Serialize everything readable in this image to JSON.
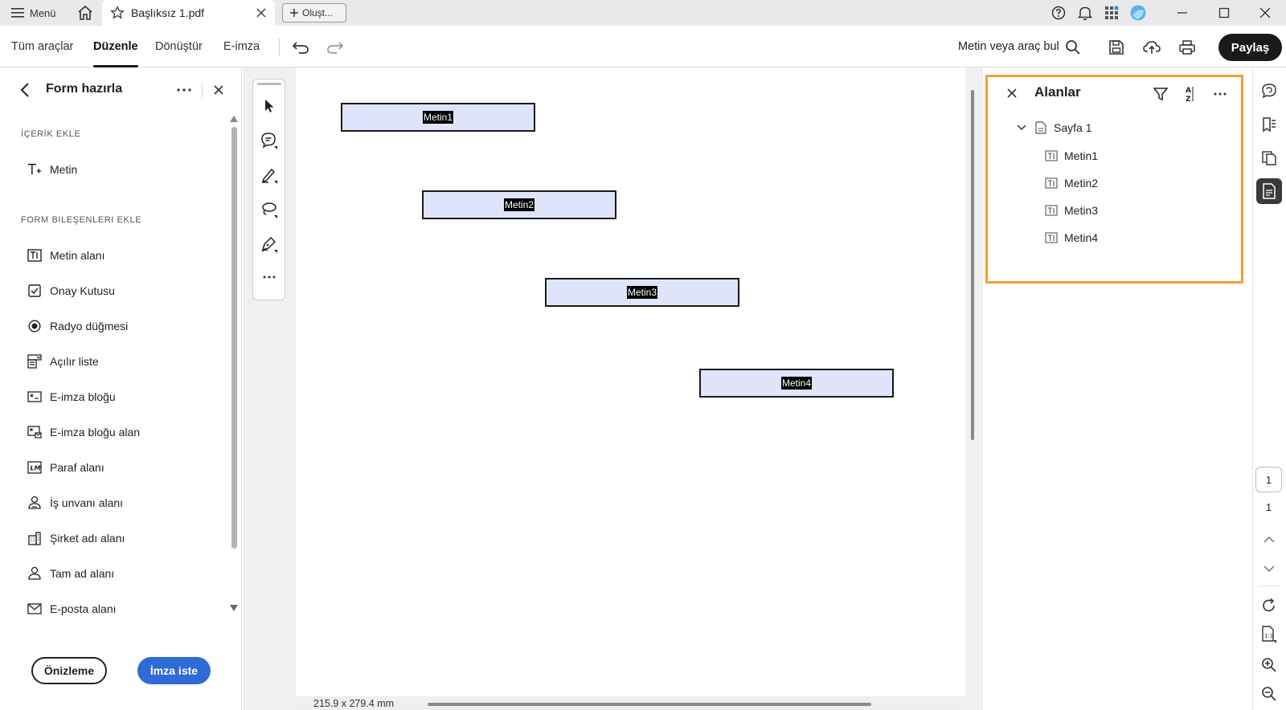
{
  "tabbar": {
    "menu_label": "Menü",
    "doc_tab_title": "Başlıksız 1.pdf",
    "new_tab_label": "Oluşt..."
  },
  "toolbar": {
    "tabs": [
      "Tüm araçlar",
      "Düzenle",
      "Dönüştür",
      "E-imza"
    ],
    "active_tab": "Düzenle",
    "search_label": "Metin veya araç bul",
    "share_label": "Paylaş"
  },
  "left_panel": {
    "title": "Form hazırla",
    "section_content": "İÇERİK EKLE",
    "content_items": [
      "Metin"
    ],
    "section_components": "FORM BILEŞENLERI EKLE",
    "component_items": [
      "Metin alanı",
      "Onay Kutusu",
      "Radyo düğmesi",
      "Açılır liste",
      "E-imza bloğu",
      "E-imza bloğu alan",
      "Paraf alanı",
      "İş unvanı alanı",
      "Şirket adı alanı",
      "Tam ad alanı",
      "E-posta alanı"
    ],
    "preview_button": "Önizleme",
    "request_button": "İmza iste"
  },
  "document": {
    "fields": [
      "Metin1",
      "Metin2",
      "Metin3",
      "Metin4"
    ],
    "page_size": "215.9 x 279.4 mm"
  },
  "fields_panel": {
    "title": "Alanlar",
    "page_label": "Sayfa 1",
    "fields": [
      "Metin1",
      "Metin2",
      "Metin3",
      "Metin4"
    ],
    "highlight_color": "#f0a030"
  },
  "rail": {
    "current_page": "1",
    "total_pages": "1"
  },
  "colors": {
    "field_fill": "#dfe4fb",
    "primary_button": "#2e6bd6",
    "share_button": "#1a1a1a"
  }
}
